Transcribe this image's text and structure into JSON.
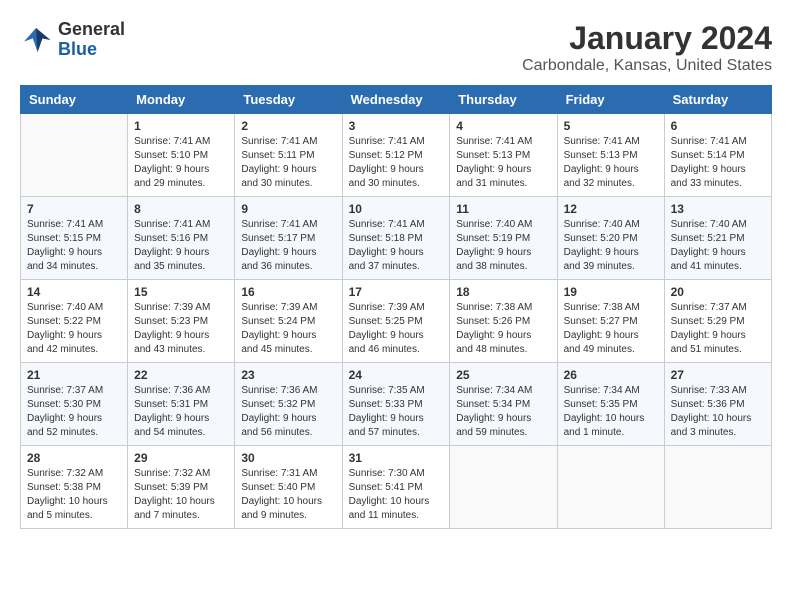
{
  "header": {
    "logo_general": "General",
    "logo_blue": "Blue",
    "title": "January 2024",
    "subtitle": "Carbondale, Kansas, United States"
  },
  "calendar": {
    "days_of_week": [
      "Sunday",
      "Monday",
      "Tuesday",
      "Wednesday",
      "Thursday",
      "Friday",
      "Saturday"
    ],
    "weeks": [
      [
        {
          "day": "",
          "info": ""
        },
        {
          "day": "1",
          "info": "Sunrise: 7:41 AM\nSunset: 5:10 PM\nDaylight: 9 hours\nand 29 minutes."
        },
        {
          "day": "2",
          "info": "Sunrise: 7:41 AM\nSunset: 5:11 PM\nDaylight: 9 hours\nand 30 minutes."
        },
        {
          "day": "3",
          "info": "Sunrise: 7:41 AM\nSunset: 5:12 PM\nDaylight: 9 hours\nand 30 minutes."
        },
        {
          "day": "4",
          "info": "Sunrise: 7:41 AM\nSunset: 5:13 PM\nDaylight: 9 hours\nand 31 minutes."
        },
        {
          "day": "5",
          "info": "Sunrise: 7:41 AM\nSunset: 5:13 PM\nDaylight: 9 hours\nand 32 minutes."
        },
        {
          "day": "6",
          "info": "Sunrise: 7:41 AM\nSunset: 5:14 PM\nDaylight: 9 hours\nand 33 minutes."
        }
      ],
      [
        {
          "day": "7",
          "info": "Sunrise: 7:41 AM\nSunset: 5:15 PM\nDaylight: 9 hours\nand 34 minutes."
        },
        {
          "day": "8",
          "info": "Sunrise: 7:41 AM\nSunset: 5:16 PM\nDaylight: 9 hours\nand 35 minutes."
        },
        {
          "day": "9",
          "info": "Sunrise: 7:41 AM\nSunset: 5:17 PM\nDaylight: 9 hours\nand 36 minutes."
        },
        {
          "day": "10",
          "info": "Sunrise: 7:41 AM\nSunset: 5:18 PM\nDaylight: 9 hours\nand 37 minutes."
        },
        {
          "day": "11",
          "info": "Sunrise: 7:40 AM\nSunset: 5:19 PM\nDaylight: 9 hours\nand 38 minutes."
        },
        {
          "day": "12",
          "info": "Sunrise: 7:40 AM\nSunset: 5:20 PM\nDaylight: 9 hours\nand 39 minutes."
        },
        {
          "day": "13",
          "info": "Sunrise: 7:40 AM\nSunset: 5:21 PM\nDaylight: 9 hours\nand 41 minutes."
        }
      ],
      [
        {
          "day": "14",
          "info": "Sunrise: 7:40 AM\nSunset: 5:22 PM\nDaylight: 9 hours\nand 42 minutes."
        },
        {
          "day": "15",
          "info": "Sunrise: 7:39 AM\nSunset: 5:23 PM\nDaylight: 9 hours\nand 43 minutes."
        },
        {
          "day": "16",
          "info": "Sunrise: 7:39 AM\nSunset: 5:24 PM\nDaylight: 9 hours\nand 45 minutes."
        },
        {
          "day": "17",
          "info": "Sunrise: 7:39 AM\nSunset: 5:25 PM\nDaylight: 9 hours\nand 46 minutes."
        },
        {
          "day": "18",
          "info": "Sunrise: 7:38 AM\nSunset: 5:26 PM\nDaylight: 9 hours\nand 48 minutes."
        },
        {
          "day": "19",
          "info": "Sunrise: 7:38 AM\nSunset: 5:27 PM\nDaylight: 9 hours\nand 49 minutes."
        },
        {
          "day": "20",
          "info": "Sunrise: 7:37 AM\nSunset: 5:29 PM\nDaylight: 9 hours\nand 51 minutes."
        }
      ],
      [
        {
          "day": "21",
          "info": "Sunrise: 7:37 AM\nSunset: 5:30 PM\nDaylight: 9 hours\nand 52 minutes."
        },
        {
          "day": "22",
          "info": "Sunrise: 7:36 AM\nSunset: 5:31 PM\nDaylight: 9 hours\nand 54 minutes."
        },
        {
          "day": "23",
          "info": "Sunrise: 7:36 AM\nSunset: 5:32 PM\nDaylight: 9 hours\nand 56 minutes."
        },
        {
          "day": "24",
          "info": "Sunrise: 7:35 AM\nSunset: 5:33 PM\nDaylight: 9 hours\nand 57 minutes."
        },
        {
          "day": "25",
          "info": "Sunrise: 7:34 AM\nSunset: 5:34 PM\nDaylight: 9 hours\nand 59 minutes."
        },
        {
          "day": "26",
          "info": "Sunrise: 7:34 AM\nSunset: 5:35 PM\nDaylight: 10 hours\nand 1 minute."
        },
        {
          "day": "27",
          "info": "Sunrise: 7:33 AM\nSunset: 5:36 PM\nDaylight: 10 hours\nand 3 minutes."
        }
      ],
      [
        {
          "day": "28",
          "info": "Sunrise: 7:32 AM\nSunset: 5:38 PM\nDaylight: 10 hours\nand 5 minutes."
        },
        {
          "day": "29",
          "info": "Sunrise: 7:32 AM\nSunset: 5:39 PM\nDaylight: 10 hours\nand 7 minutes."
        },
        {
          "day": "30",
          "info": "Sunrise: 7:31 AM\nSunset: 5:40 PM\nDaylight: 10 hours\nand 9 minutes."
        },
        {
          "day": "31",
          "info": "Sunrise: 7:30 AM\nSunset: 5:41 PM\nDaylight: 10 hours\nand 11 minutes."
        },
        {
          "day": "",
          "info": ""
        },
        {
          "day": "",
          "info": ""
        },
        {
          "day": "",
          "info": ""
        }
      ]
    ]
  }
}
